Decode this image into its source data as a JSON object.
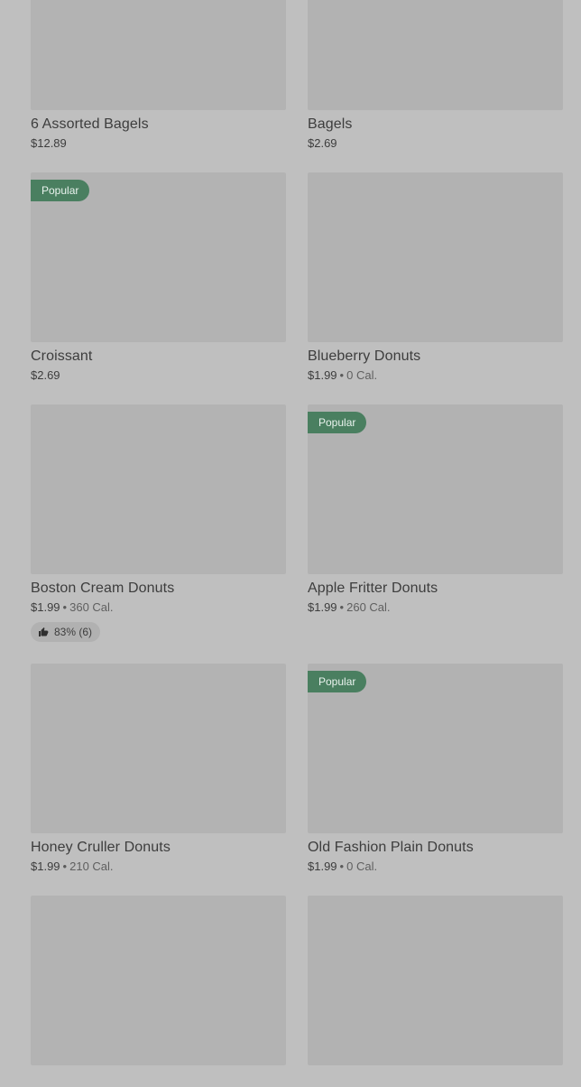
{
  "items": [
    {
      "name": "6 Assorted Bagels",
      "price": "$12.89",
      "separator": "",
      "calories": "",
      "badge": "",
      "rating": ""
    },
    {
      "name": "Bagels",
      "price": "$2.69",
      "separator": "",
      "calories": "",
      "badge": "",
      "rating": ""
    },
    {
      "name": "Croissant",
      "price": "$2.69",
      "separator": "",
      "calories": "",
      "badge": "Popular",
      "rating": ""
    },
    {
      "name": "Blueberry Donuts",
      "price": "$1.99",
      "separator": "•",
      "calories": "0 Cal.",
      "badge": "",
      "rating": ""
    },
    {
      "name": "Boston Cream Donuts",
      "price": "$1.99",
      "separator": "•",
      "calories": "360 Cal.",
      "badge": "",
      "rating": "83% (6)"
    },
    {
      "name": "Apple Fritter Donuts",
      "price": "$1.99",
      "separator": "•",
      "calories": "260 Cal.",
      "badge": "Popular",
      "rating": ""
    },
    {
      "name": "Honey Cruller Donuts",
      "price": "$1.99",
      "separator": "•",
      "calories": "210 Cal.",
      "badge": "",
      "rating": ""
    },
    {
      "name": "Old Fashion Plain Donuts",
      "price": "$1.99",
      "separator": "•",
      "calories": "0 Cal.",
      "badge": "Popular",
      "rating": ""
    }
  ],
  "colors": {
    "background": "#bfbfbf",
    "image_placeholder": "#b3b3b3",
    "badge_bg": "#4a7f60",
    "text": "#3d3d3d"
  },
  "icons": {
    "rating": "thumbs-up-icon"
  }
}
